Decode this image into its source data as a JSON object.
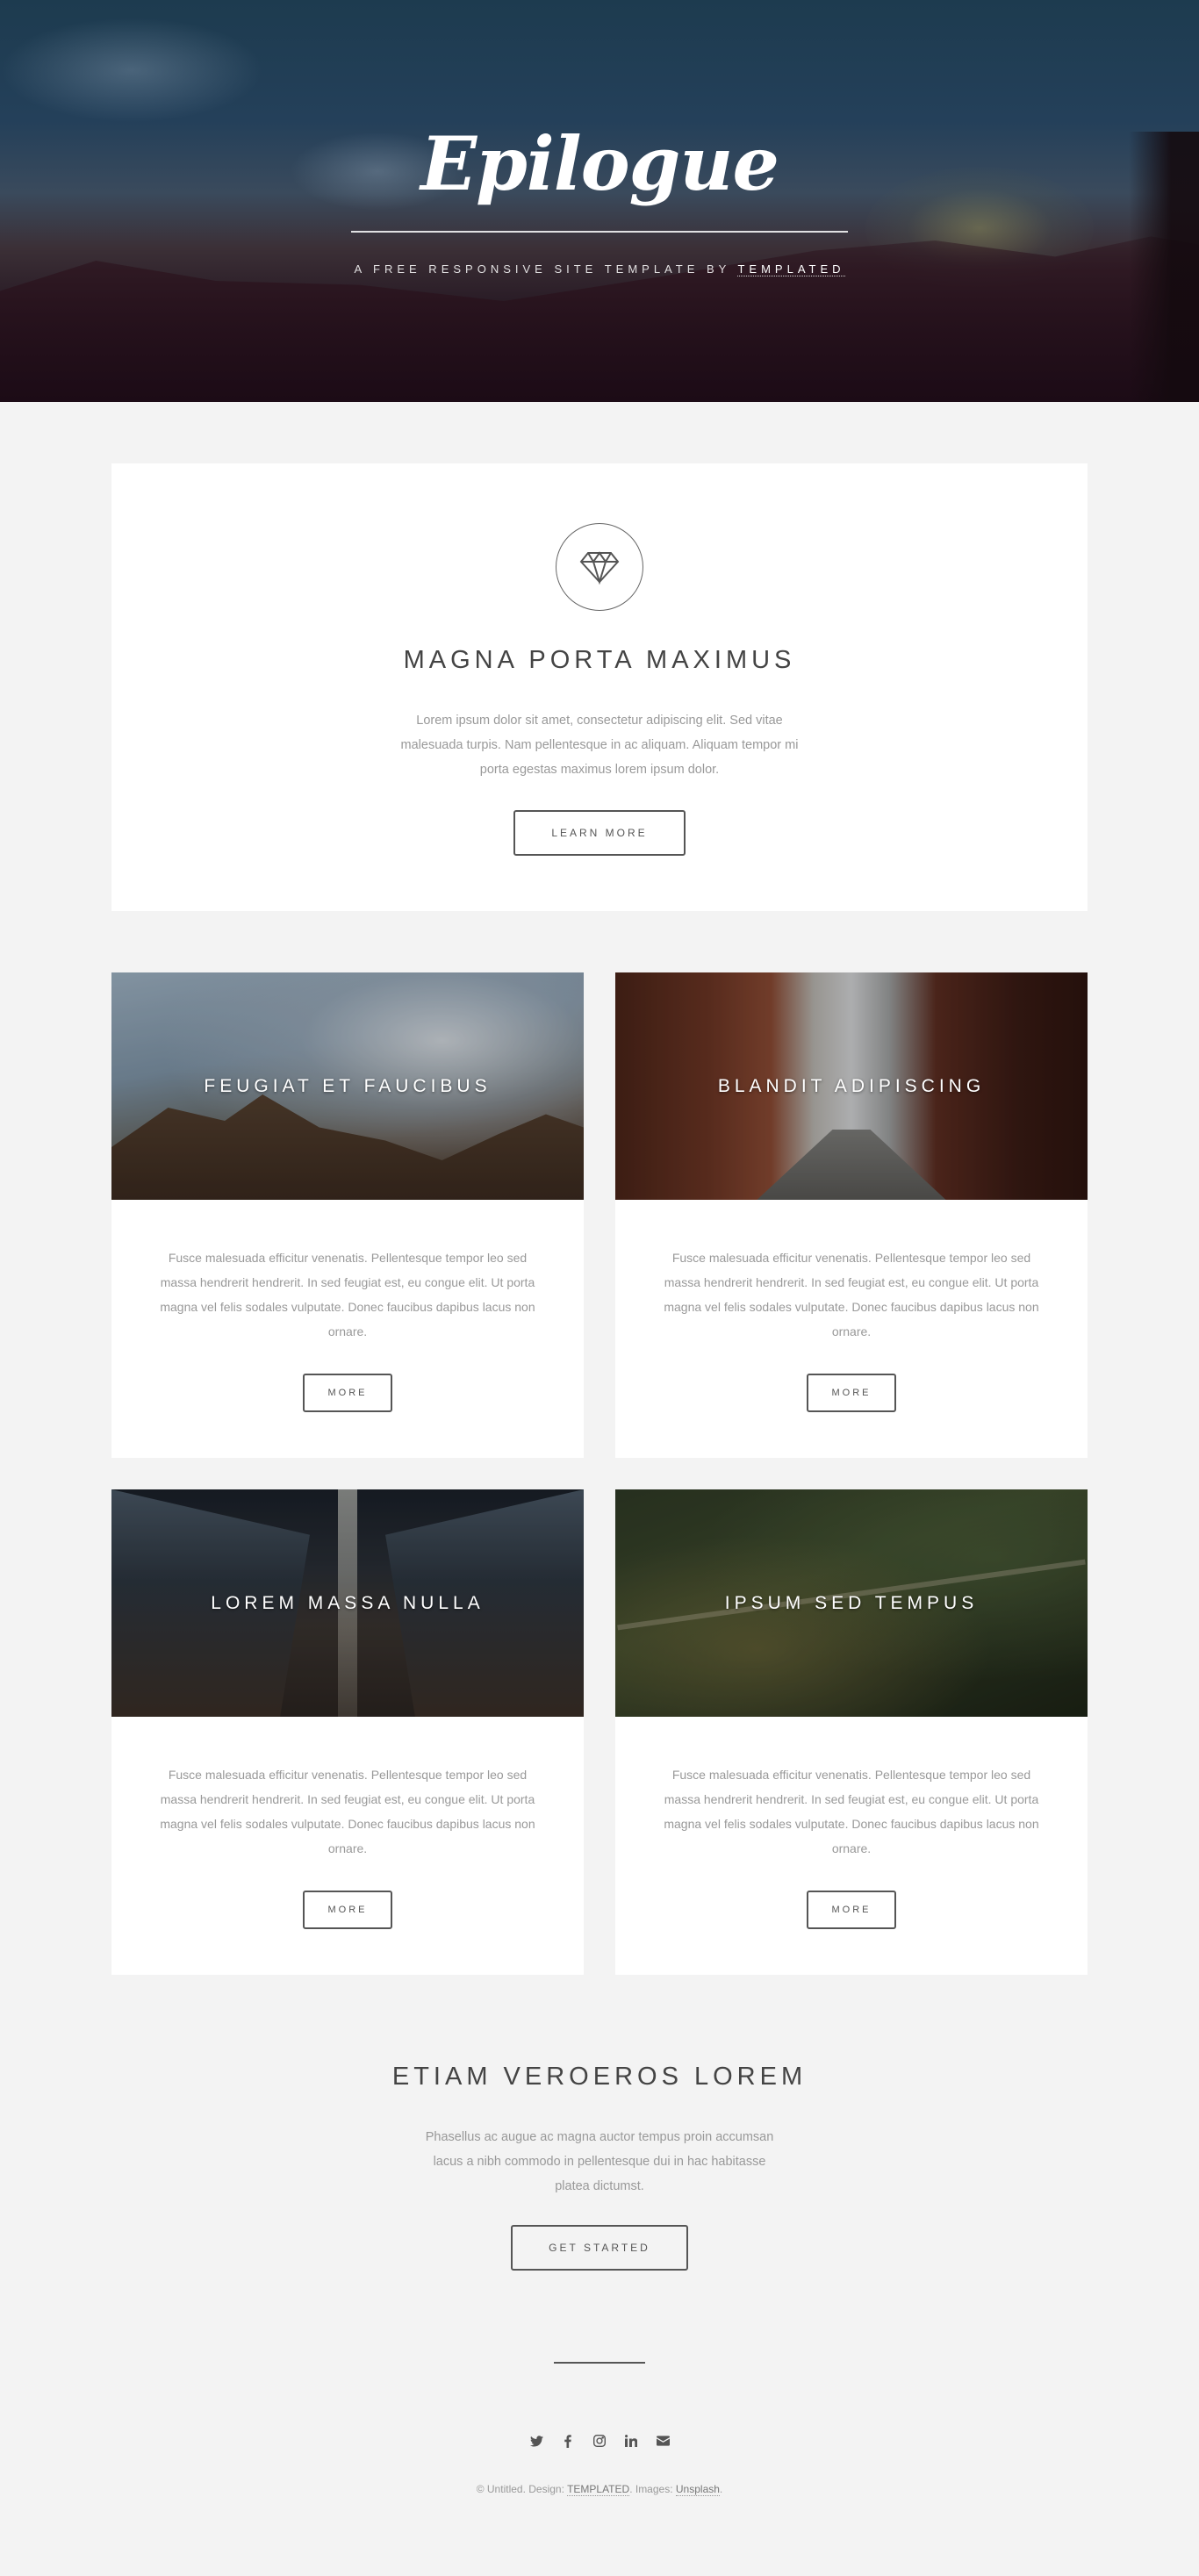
{
  "banner": {
    "logo": "Epilogue",
    "tagline_prefix": "A free responsive site template by",
    "tagline_link": "TEMPLATED"
  },
  "intro": {
    "icon": "diamond-icon",
    "title": "Magna porta maximus",
    "text": "Lorem ipsum dolor sit amet, consectetur adipiscing elit. Sed vitae malesuada turpis. Nam pellentesque in ac aliquam. Aliquam tempor mi porta egestas maximus lorem ipsum dolor.",
    "button": "Learn More"
  },
  "cards": [
    {
      "title": "Feugiat et faucibus",
      "text": "Fusce malesuada efficitur venenatis. Pellentesque tempor leo sed massa hendrerit hendrerit. In sed feugiat est, eu congue elit. Ut porta magna vel felis sodales vulputate. Donec faucibus dapibus lacus non ornare.",
      "button": "More"
    },
    {
      "title": "Blandit adipiscing",
      "text": "Fusce malesuada efficitur venenatis. Pellentesque tempor leo sed massa hendrerit hendrerit. In sed feugiat est, eu congue elit. Ut porta magna vel felis sodales vulputate. Donec faucibus dapibus lacus non ornare.",
      "button": "More"
    },
    {
      "title": "Lorem massa nulla",
      "text": "Fusce malesuada efficitur venenatis. Pellentesque tempor leo sed massa hendrerit hendrerit. In sed feugiat est, eu congue elit. Ut porta magna vel felis sodales vulputate. Donec faucibus dapibus lacus non ornare.",
      "button": "More"
    },
    {
      "title": "Ipsum sed tempus",
      "text": "Fusce malesuada efficitur venenatis. Pellentesque tempor leo sed massa hendrerit hendrerit. In sed feugiat est, eu congue elit. Ut porta magna vel felis sodales vulputate. Donec faucibus dapibus lacus non ornare.",
      "button": "More"
    }
  ],
  "cta": {
    "title": "Etiam veroeros lorem",
    "text": "Phasellus ac augue ac magna auctor tempus proin accumsan lacus a nibh commodo in pellentesque dui in hac habitasse platea dictumst.",
    "button": "Get Started"
  },
  "footer": {
    "social_icons": [
      "twitter-icon",
      "facebook-icon",
      "instagram-icon",
      "linkedin-icon",
      "envelope-icon"
    ],
    "copyright_prefix": "© Untitled. Design:",
    "design_link": "TEMPLATED",
    "images_prefix": ". Images:",
    "images_link": "Unsplash",
    "suffix": "."
  }
}
